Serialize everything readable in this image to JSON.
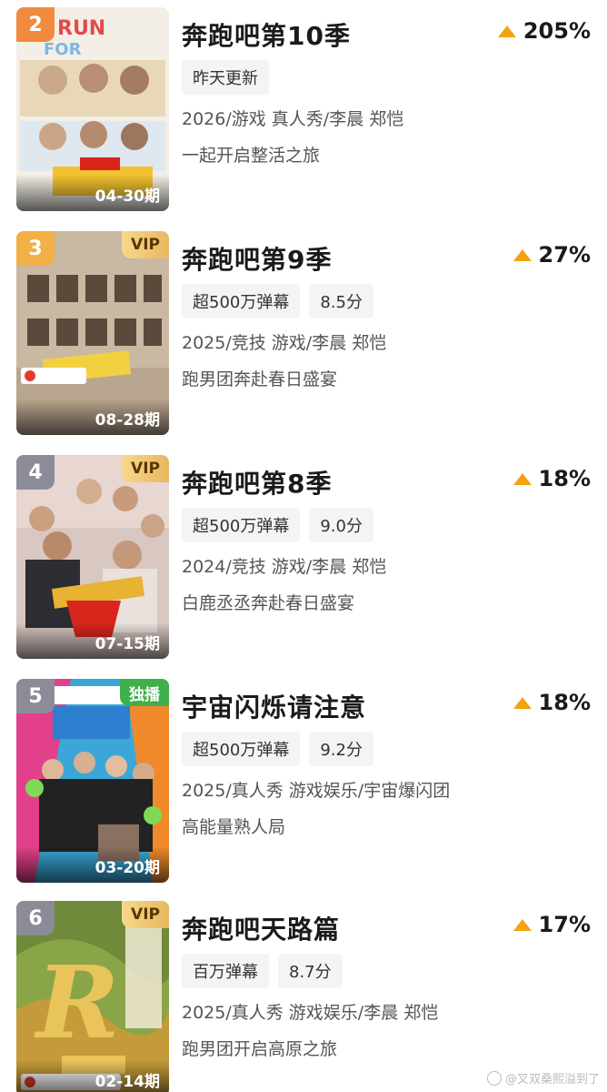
{
  "items": [
    {
      "rank": "2",
      "rank_color": "#f08a3c",
      "corner_tag": "",
      "episode": "04-30期",
      "title": "奔跑吧第10季",
      "trend": "205%",
      "chips": [
        "昨天更新"
      ],
      "meta": "2026/游戏 真人秀/李晨 郑恺",
      "desc": "一起开启整活之旅"
    },
    {
      "rank": "3",
      "rank_color": "#f2b046",
      "corner_tag": "VIP",
      "episode": "08-28期",
      "title": "奔跑吧第9季",
      "trend": "27%",
      "chips": [
        "超500万弹幕",
        "8.5分"
      ],
      "meta": "2025/竞技 游戏/李晨 郑恺",
      "desc": "跑男团奔赴春日盛宴"
    },
    {
      "rank": "4",
      "rank_color": "#8c8c98",
      "corner_tag": "VIP",
      "episode": "07-15期",
      "title": "奔跑吧第8季",
      "trend": "18%",
      "chips": [
        "超500万弹幕",
        "9.0分"
      ],
      "meta": "2024/竞技 游戏/李晨 郑恺",
      "desc": "白鹿丞丞奔赴春日盛宴"
    },
    {
      "rank": "5",
      "rank_color": "#8c8c98",
      "corner_tag": "独播",
      "episode": "03-20期",
      "title": "宇宙闪烁请注意",
      "trend": "18%",
      "chips": [
        "超500万弹幕",
        "9.2分"
      ],
      "meta": "2025/真人秀 游戏娱乐/宇宙爆闪团",
      "desc": "高能量熟人局"
    },
    {
      "rank": "6",
      "rank_color": "#8c8c98",
      "corner_tag": "VIP",
      "episode": "02-14期",
      "title": "奔跑吧天路篇",
      "trend": "17%",
      "chips": [
        "百万弹幕",
        "8.7分"
      ],
      "meta": "2025/真人秀 游戏娱乐/李晨 郑恺",
      "desc": "跑男团开启高原之旅"
    }
  ],
  "watermark": "@叉双桑熙溢到了"
}
